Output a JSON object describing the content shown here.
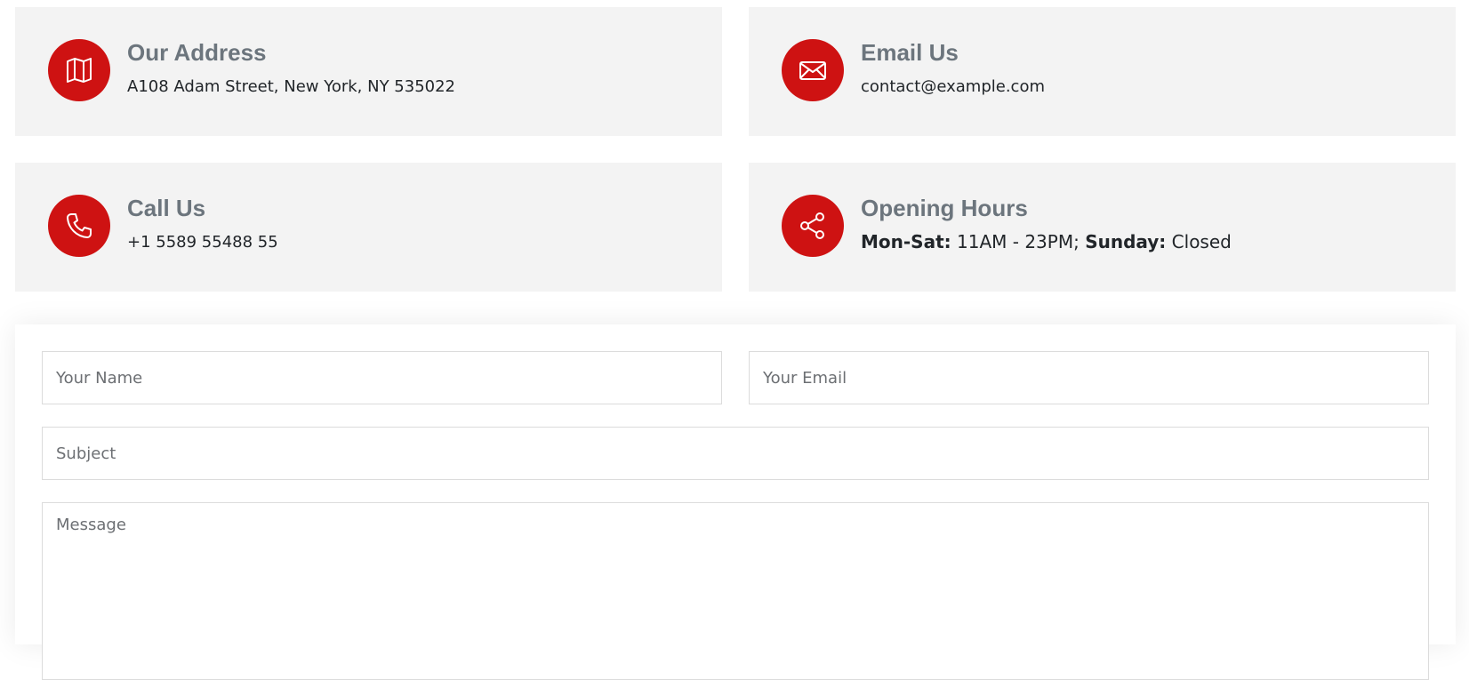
{
  "colors": {
    "accent": "#ce1212",
    "card_bg": "#f3f3f3",
    "title": "#6c757d",
    "text": "#212529"
  },
  "info_cards": [
    {
      "icon": "map-icon",
      "title": "Our Address",
      "text": "A108 Adam Street, New York, NY 535022"
    },
    {
      "icon": "envelope-icon",
      "title": "Email Us",
      "text": "contact@example.com"
    },
    {
      "icon": "phone-icon",
      "title": "Call Us",
      "text": "+1 5589 55488 55"
    },
    {
      "icon": "share-icon",
      "title": "Opening Hours",
      "hours": {
        "weekday_label": "Mon-Sat:",
        "weekday_value": " 11AM - 23PM; ",
        "sunday_label": "Sunday:",
        "sunday_value": " Closed"
      }
    }
  ],
  "form": {
    "name_placeholder": "Your Name",
    "email_placeholder": "Your Email",
    "subject_placeholder": "Subject",
    "message_placeholder": "Message"
  }
}
